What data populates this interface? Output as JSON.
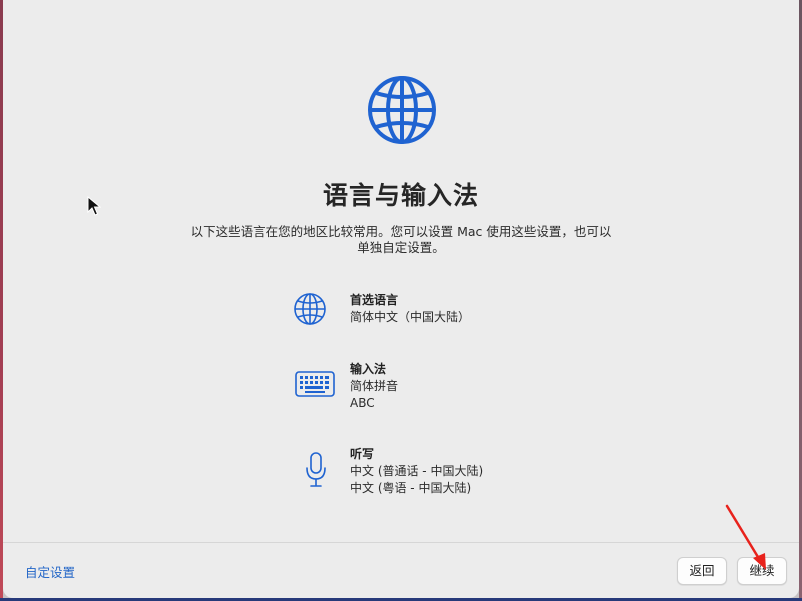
{
  "page": {
    "title": "语言与输入法",
    "subtitle_line1": "以下这些语言在您的地区比较常用。您可以设置 Mac 使用这些设置，也可以",
    "subtitle_line2": "单独自定设置。"
  },
  "settings": [
    {
      "label": "首选语言",
      "values": [
        "简体中文（中国大陆）"
      ],
      "icon": "globe-icon"
    },
    {
      "label": "输入法",
      "values": [
        "简体拼音",
        "ABC"
      ],
      "icon": "keyboard-icon"
    },
    {
      "label": "听写",
      "values": [
        "中文 (普通话 - 中国大陆)",
        "中文 (粤语 - 中国大陆)"
      ],
      "icon": "microphone-icon"
    }
  ],
  "footer": {
    "customize_label": "自定设置",
    "back_label": "返回",
    "continue_label": "继续"
  },
  "colors": {
    "accent": "#1f63d1",
    "link": "#2366c7",
    "annotation": "#e8221c"
  }
}
